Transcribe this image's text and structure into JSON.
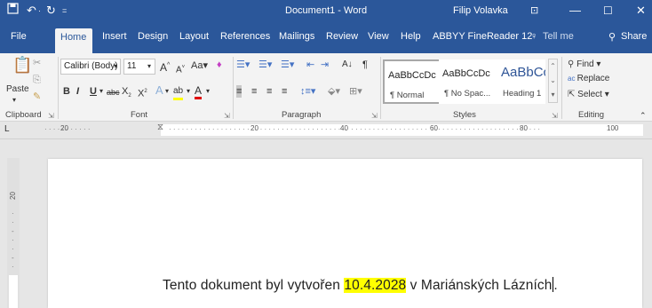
{
  "titlebar": {
    "doc_title": "Document1 - Word",
    "user": "Filip Volavka"
  },
  "tabs": [
    "File",
    "Home",
    "Insert",
    "Design",
    "Layout",
    "References",
    "Mailings",
    "Review",
    "View",
    "Help",
    "ABBYY FineReader 12"
  ],
  "tell_me": "Tell me",
  "share": "Share",
  "clipboard": {
    "paste": "Paste",
    "label": "Clipboard"
  },
  "font": {
    "name": "Calibri (Body)",
    "size": "11",
    "label": "Font"
  },
  "paragraph": {
    "label": "Paragraph"
  },
  "styles": {
    "label": "Styles",
    "items": [
      {
        "preview": "AaBbCcDc",
        "name": "¶ Normal"
      },
      {
        "preview": "AaBbCcDc",
        "name": "¶ No Spac..."
      },
      {
        "preview": "AaBbCc",
        "name": "Heading 1"
      }
    ]
  },
  "editing": {
    "label": "Editing",
    "find": "Find",
    "replace": "Replace",
    "select": "Select"
  },
  "ruler": {
    "numbers": [
      "20",
      "20",
      "40",
      "60",
      "80",
      "100"
    ]
  },
  "vruler": {
    "number": "20"
  },
  "document": {
    "before": "Tento dokument byl vytvořen ",
    "highlight": "10.4.2028",
    "after": " v Mariánských Lázních"
  }
}
